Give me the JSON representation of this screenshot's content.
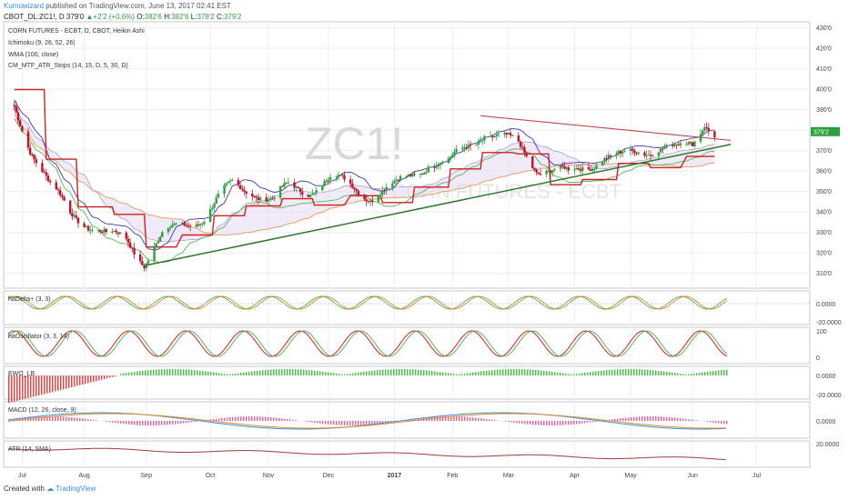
{
  "header": {
    "author": "Kumowizard",
    "published": "published on TradingView.com, June 13, 2017 02:41 EST",
    "symbol": "CBOT_DL:ZC1!, D",
    "last": "379'0",
    "change": "+2'2 (+0.6%)",
    "o_label": "O:",
    "o": "382'6",
    "h_label": "H:",
    "h": "382'6",
    "l_label": "L:",
    "l": "378'2",
    "c_label": "C:",
    "c": "379'2"
  },
  "legend": {
    "title": "CORN FUTURES - ECBT, D, CBOT, Heikin Ashi",
    "ichimoku": "Ichimoku (9, 26, 52, 26)",
    "wma": "WMA (100, close)",
    "atr_stops": "CM_MTF_ATR_Stops (14, 15, D, 5, 30, D)"
  },
  "watermark": {
    "symbol": "ZC1!",
    "sub": "CORN FUTURES - ECBT"
  },
  "panes": {
    "hadelta": {
      "label": "haDelta+ (3, 3)",
      "ticks": [
        "0.0000",
        "-20.0000"
      ]
    },
    "haosc": {
      "label": "haOscillator (3, 3, 14)",
      "ticks": [
        "100",
        "0"
      ]
    },
    "ewo": {
      "label": "EWO_LB",
      "ticks": [
        "0.0000",
        "-20.0000"
      ]
    },
    "macd": {
      "label": "MACD (12, 26, close, 9)",
      "ticks": [
        "0.0000"
      ]
    },
    "atr": {
      "label": "ATR (14, SMA)",
      "ticks": [
        "20.0000"
      ]
    }
  },
  "x_axis": [
    "Jul",
    "Aug",
    "Sep",
    "Oct",
    "Nov",
    "Dec",
    "2017",
    "Feb",
    "Mar",
    "Apr",
    "May",
    "Jun",
    "Jul"
  ],
  "footer": {
    "created": "Created with",
    "brand": "TradingView"
  },
  "colors": {
    "up": "#2e9e40",
    "down": "#b5162a",
    "trend": "#2a7a2a",
    "resist": "#b84b4b",
    "brand": "#3d8ad6"
  },
  "chart_data": {
    "type": "candlestick",
    "title": "CORN FUTURES - ECBT, D, CBOT, Heikin Ashi",
    "y_ticks": [
      "430'0",
      "420'0",
      "410'0",
      "400'0",
      "390'0",
      "380'0",
      "370'0",
      "360'0",
      "350'0",
      "340'0",
      "330'0",
      "320'0",
      "310'0"
    ],
    "ylim": [
      305,
      432
    ],
    "x_ticks": [
      "Jul",
      "Aug",
      "Sep",
      "Oct",
      "Nov",
      "Dec",
      "2017",
      "Feb",
      "Mar",
      "Apr",
      "May",
      "Jun",
      "Jul"
    ],
    "close_path": [
      [
        "2016-06-27",
        392
      ],
      [
        "2016-07-05",
        372
      ],
      [
        "2016-07-15",
        352
      ],
      [
        "2016-07-25",
        340
      ],
      [
        "2016-08-01",
        336
      ],
      [
        "2016-08-12",
        328
      ],
      [
        "2016-08-22",
        327
      ],
      [
        "2016-08-31",
        316
      ],
      [
        "2016-09-09",
        328
      ],
      [
        "2016-09-20",
        334
      ],
      [
        "2016-09-30",
        338
      ],
      [
        "2016-10-07",
        346
      ],
      [
        "2016-10-14",
        353
      ],
      [
        "2016-10-24",
        351
      ],
      [
        "2016-11-03",
        345
      ],
      [
        "2016-11-11",
        352
      ],
      [
        "2016-11-22",
        351
      ],
      [
        "2016-12-02",
        356
      ],
      [
        "2016-12-12",
        353
      ],
      [
        "2016-12-22",
        348
      ],
      [
        "2017-01-03",
        352
      ],
      [
        "2017-01-11",
        358
      ],
      [
        "2017-01-20",
        364
      ],
      [
        "2017-01-30",
        363
      ],
      [
        "2017-02-08",
        372
      ],
      [
        "2017-02-17",
        379
      ],
      [
        "2017-02-27",
        375
      ],
      [
        "2017-03-06",
        373
      ],
      [
        "2017-03-15",
        362
      ],
      [
        "2017-03-24",
        360
      ],
      [
        "2017-03-31",
        358
      ],
      [
        "2017-04-07",
        362
      ],
      [
        "2017-04-17",
        367
      ],
      [
        "2017-04-26",
        366
      ],
      [
        "2017-05-05",
        370
      ],
      [
        "2017-05-15",
        372
      ],
      [
        "2017-05-24",
        370
      ],
      [
        "2017-06-01",
        373
      ],
      [
        "2017-06-07",
        385
      ],
      [
        "2017-06-12",
        379
      ]
    ],
    "trendline_support": [
      [
        "2016-09-01",
        314
      ],
      [
        "2017-06-20",
        373
      ]
    ],
    "trendline_resistance": [
      [
        "2017-02-15",
        387
      ],
      [
        "2017-06-20",
        375
      ]
    ],
    "last_close": "379'2"
  }
}
